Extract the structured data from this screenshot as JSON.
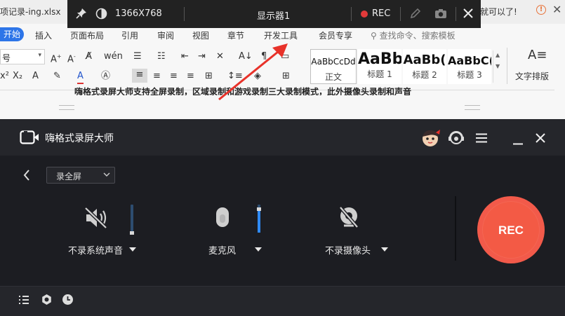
{
  "word_processor": {
    "filename": "项记录-ing.xlsx",
    "title_tail": "就可以了!",
    "menu": [
      "开始",
      "插入",
      "页面布局",
      "引用",
      "审阅",
      "视图",
      "章节",
      "开发工具",
      "会员专享"
    ],
    "search_placeholder": "查找命令、搜索模板",
    "font_size_value": "号",
    "styles": [
      {
        "sample": "AaBbCcDd",
        "label": "正文"
      },
      {
        "sample": "AaBb",
        "label": "标题 1"
      },
      {
        "sample": "AaBb(",
        "label": "标题 2"
      },
      {
        "sample": "AaBbC(",
        "label": "标题 3"
      }
    ],
    "text_layout_label": "文字排版",
    "doc_text": "嗨格式录屏大师支持全屏录制，区域录制和游戏录制三大录制模式，此外摄像头录制和声音"
  },
  "float_bar": {
    "resolution": "1366X768",
    "display": "显示器1",
    "rec_label": "REC"
  },
  "app": {
    "title": "嗨格式录屏大师",
    "mode": "录全屏",
    "controls": {
      "system_audio": {
        "label": "不录系统声音",
        "level": 0.0
      },
      "microphone": {
        "label": "麦克风",
        "level": 0.85
      },
      "camera": {
        "label": "不录摄像头"
      }
    },
    "rec_button": "REC"
  },
  "colors": {
    "accent_blue": "#2f8af5",
    "rec_red": "#f35a45",
    "arrow_red": "#e8322a",
    "app_bg": "#1c1d22"
  }
}
